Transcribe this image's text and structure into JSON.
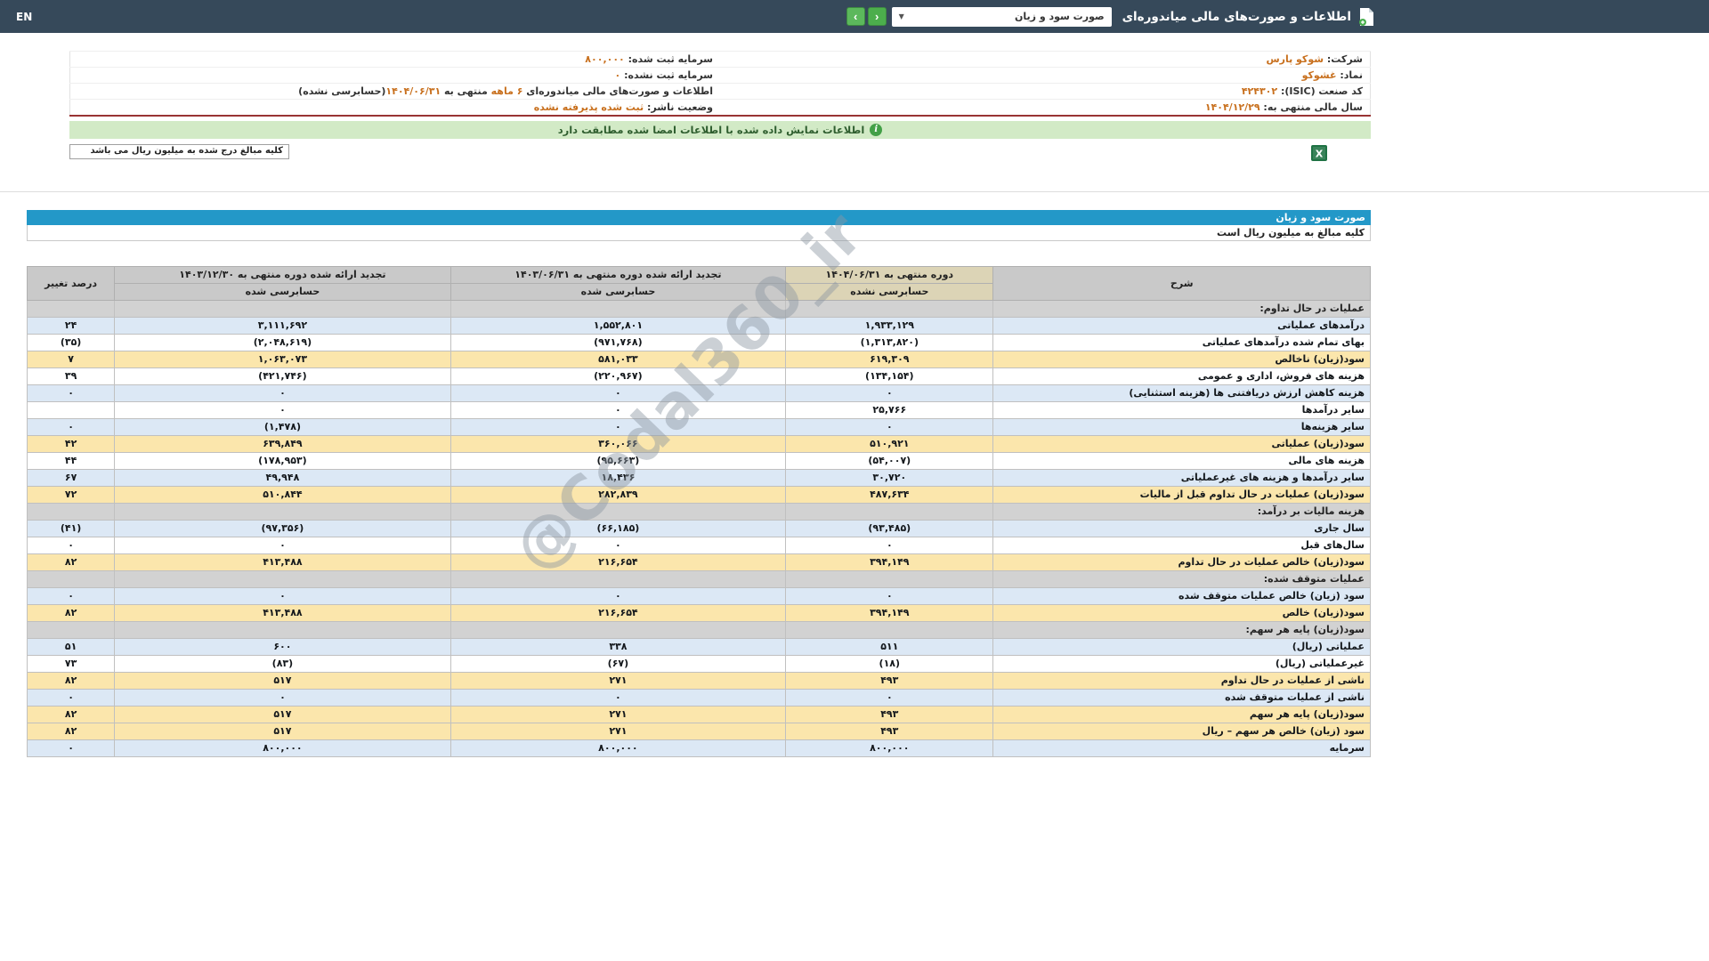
{
  "colors": {
    "navbar_bg": "#36495a",
    "accent_teal": "#2398c8",
    "row_blue": "#dce8f5",
    "row_yellow": "#fbe6ac",
    "section_gray": "#d2d2d2",
    "header_gray": "#c9c9c9",
    "header_cream": "#dcd4b6",
    "negative_red": "#d60000",
    "company_value_orange": "#c8701e",
    "banner_green_bg": "#d2eac6",
    "nav_button_green": "#4cae4c",
    "info_bottom_line_red": "#993333"
  },
  "navbar": {
    "title": "اطلاعات و صورت‌های مالی میاندوره‌ای",
    "report_select_value": "صورت سود و زیان",
    "select_caret": "▼",
    "prev_button": "‹",
    "next_button": "›",
    "lang_link": "EN"
  },
  "company_info": {
    "rows": [
      {
        "right_label": "شرکت:",
        "right_value": "شوکو پارس",
        "left_label": "سرمایه ثبت شده:",
        "left_value": "۸۰۰,۰۰۰"
      },
      {
        "right_label": "نماد:",
        "right_value": "غشوکو",
        "left_label": "سرمایه ثبت نشده:",
        "left_value": "۰"
      },
      {
        "right_label": "کد صنعت (ISIC):",
        "right_value": "۴۲۴۳۰۲",
        "left_parts": {
          "p1": "اطلاعات و صورت‌های مالی میاندوره‌ای ",
          "h1": "۶ ماهه",
          "p2": " منتهی به ",
          "h2": "۱۴۰۴/۰۶/۳۱",
          "p3": "(حسابرسی نشده)"
        }
      },
      {
        "right_label": "سال مالی منتهی به:",
        "right_value": "۱۴۰۴/۱۲/۲۹",
        "left_label": "وضعیت ناشر:",
        "left_value": "ثبت شده پذیرفته نشده"
      }
    ]
  },
  "signature_banner": {
    "text": "اطلاعات نمایش داده شده با اطلاعات امضا شده مطابقت دارد",
    "icon": "i"
  },
  "tools": {
    "unit_note": "کلیه مبالغ درج شده به میلیون ریال می باشد",
    "excel_icon": "excel-export"
  },
  "statement": {
    "band_title": "صورت سود و زیان",
    "unit_note": "کلیه مبالغ به میلیون ریال است",
    "watermark": "@Codal360_ir",
    "header": {
      "desc": "شرح",
      "period_current": "دوره منتهی به ۱۴۰۴/۰۶/۳۱",
      "sub_current": "حسابرسی نشده",
      "period_prev": "تجدید ارائه شده دوره منتهی به ۱۴۰۳/۰۶/۳۱",
      "sub_prev": "حسابرسی شده",
      "period_year": "تجدید ارائه شده دوره منتهی به ۱۴۰۳/۱۲/۳۰",
      "sub_year": "حسابرسی شده",
      "change": "درصد تغییر"
    },
    "rows": [
      {
        "variant": "section",
        "label": "عملیات در حال تداوم:",
        "v1": "",
        "v2": "",
        "v3": "",
        "chg": ""
      },
      {
        "variant": "blue",
        "label": "درآمدهای عملیاتی",
        "v1": "۱,۹۳۳,۱۲۹",
        "v2": "۱,۵۵۲,۸۰۱",
        "v3": "۳,۱۱۱,۶۹۲",
        "chg": "۲۴"
      },
      {
        "variant": "white",
        "label": "بهای تمام شده درآمدهای عملیاتی",
        "v1": "(۱,۳۱۳,۸۲۰)",
        "v2": "(۹۷۱,۷۶۸)",
        "v3": "(۲,۰۴۸,۶۱۹)",
        "chg": "(۳۵)"
      },
      {
        "variant": "yellow",
        "label": "سود(زیان) ناخالص",
        "v1": "۶۱۹,۳۰۹",
        "v2": "۵۸۱,۰۳۳",
        "v3": "۱,۰۶۳,۰۷۳",
        "chg": "۷"
      },
      {
        "variant": "white",
        "label": "هزینه های فروش، اداری و عمومی",
        "v1": "(۱۳۴,۱۵۴)",
        "v2": "(۲۲۰,۹۶۷)",
        "v3": "(۴۲۱,۷۴۶)",
        "chg": "۳۹"
      },
      {
        "variant": "blue",
        "label": "هزینه کاهش ارزش دریافتنی ها (هزینه استثنایی)",
        "v1": "۰",
        "v2": "۰",
        "v3": "۰",
        "chg": "۰"
      },
      {
        "variant": "white",
        "label": "سایر درآمدها",
        "v1": "۲۵,۷۶۶",
        "v2": "۰",
        "v3": "۰",
        "chg": ""
      },
      {
        "variant": "blue",
        "label": "سایر هزینه‌ها",
        "v1": "۰",
        "v2": "۰",
        "v3": "(۱,۴۷۸)",
        "chg": "۰"
      },
      {
        "variant": "yellow",
        "label": "سود(زیان) عملیاتی",
        "v1": "۵۱۰,۹۲۱",
        "v2": "۳۶۰,۰۶۶",
        "v3": "۶۳۹,۸۴۹",
        "chg": "۴۲"
      },
      {
        "variant": "white",
        "label": "هزینه های مالی",
        "v1": "(۵۴,۰۰۷)",
        "v2": "(۹۵,۶۶۳)",
        "v3": "(۱۷۸,۹۵۳)",
        "chg": "۴۴"
      },
      {
        "variant": "blue",
        "label": "سایر درآمدها و هزینه های غیرعملیاتی",
        "v1": "۳۰,۷۲۰",
        "v2": "۱۸,۴۳۶",
        "v3": "۴۹,۹۴۸",
        "chg": "۶۷"
      },
      {
        "variant": "yellow",
        "label": "سود(زیان) عملیات در حال تداوم قبل از مالیات",
        "v1": "۴۸۷,۶۳۴",
        "v2": "۲۸۲,۸۳۹",
        "v3": "۵۱۰,۸۴۴",
        "chg": "۷۲"
      },
      {
        "variant": "section",
        "label": "هزینه مالیات بر درآمد:",
        "v1": "",
        "v2": "",
        "v3": "",
        "chg": ""
      },
      {
        "variant": "blue",
        "label": "سال جاری",
        "v1": "(۹۳,۴۸۵)",
        "v2": "(۶۶,۱۸۵)",
        "v3": "(۹۷,۳۵۶)",
        "chg": "(۴۱)"
      },
      {
        "variant": "white",
        "label": "سال‌های قبل",
        "v1": "۰",
        "v2": "۰",
        "v3": "۰",
        "chg": "۰"
      },
      {
        "variant": "yellow",
        "label": "سود(زیان) خالص عملیات در حال تداوم",
        "v1": "۳۹۴,۱۴۹",
        "v2": "۲۱۶,۶۵۴",
        "v3": "۴۱۳,۴۸۸",
        "chg": "۸۲"
      },
      {
        "variant": "section",
        "label": "عملیات متوقف شده:",
        "v1": "",
        "v2": "",
        "v3": "",
        "chg": ""
      },
      {
        "variant": "blue",
        "label": "سود (زیان) خالص عملیات متوقف شده",
        "v1": "۰",
        "v2": "۰",
        "v3": "۰",
        "chg": "۰"
      },
      {
        "variant": "yellow",
        "label": "سود(زیان) خالص",
        "v1": "۳۹۴,۱۴۹",
        "v2": "۲۱۶,۶۵۴",
        "v3": "۴۱۳,۴۸۸",
        "chg": "۸۲"
      },
      {
        "variant": "section",
        "label": "سود(زیان) پایه هر سهم:",
        "v1": "",
        "v2": "",
        "v3": "",
        "chg": ""
      },
      {
        "variant": "blue",
        "label": "عملیاتی (ریال)",
        "v1": "۵۱۱",
        "v2": "۳۳۸",
        "v3": "۶۰۰",
        "chg": "۵۱"
      },
      {
        "variant": "white",
        "label": "غیرعملیاتی (ریال)",
        "v1": "(۱۸)",
        "v2": "(۶۷)",
        "v3": "(۸۳)",
        "chg": "۷۳"
      },
      {
        "variant": "yellow",
        "label": "ناشی از عملیات در حال تداوم",
        "v1": "۴۹۳",
        "v2": "۲۷۱",
        "v3": "۵۱۷",
        "chg": "۸۲"
      },
      {
        "variant": "blue",
        "label": "ناشی از عملیات متوقف شده",
        "v1": "۰",
        "v2": "۰",
        "v3": "۰",
        "chg": "۰"
      },
      {
        "variant": "yellow",
        "label": "سود(زیان) پایه هر سهم",
        "v1": "۴۹۳",
        "v2": "۲۷۱",
        "v3": "۵۱۷",
        "chg": "۸۲"
      },
      {
        "variant": "yellow",
        "label": "سود (زیان) خالص هر سهم – ریال",
        "v1": "۴۹۳",
        "v2": "۲۷۱",
        "v3": "۵۱۷",
        "chg": "۸۲"
      },
      {
        "variant": "blue",
        "label": "سرمایه",
        "v1": "۸۰۰,۰۰۰",
        "v2": "۸۰۰,۰۰۰",
        "v3": "۸۰۰,۰۰۰",
        "chg": "۰"
      }
    ]
  }
}
